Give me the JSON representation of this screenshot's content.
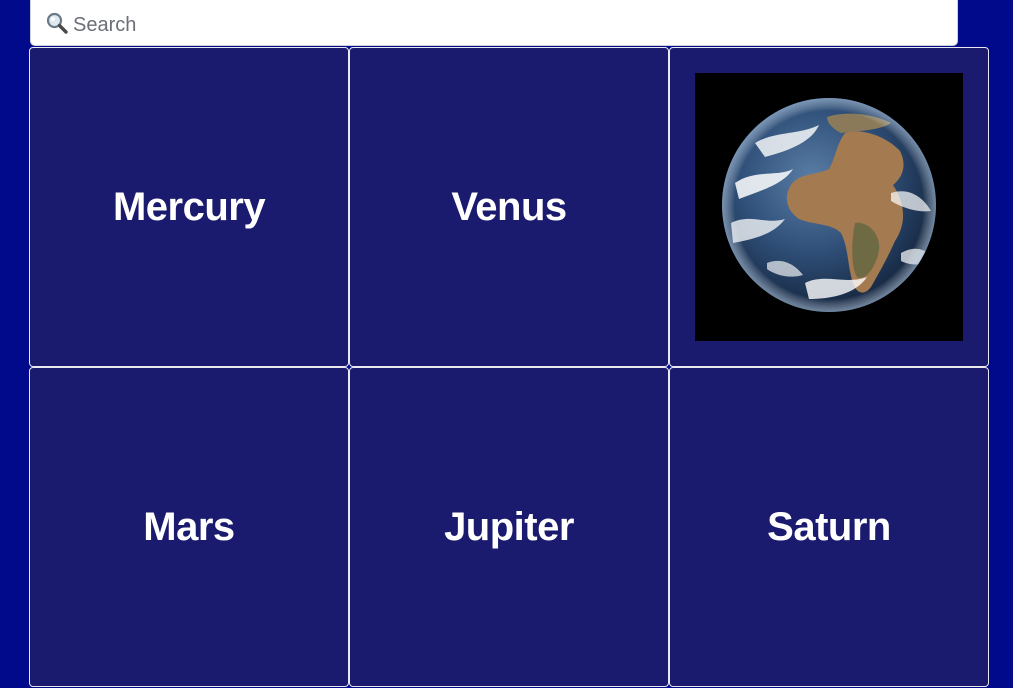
{
  "search": {
    "placeholder": "Search",
    "value": ""
  },
  "planets": [
    {
      "label": "Mercury",
      "shows_image": false
    },
    {
      "label": "Venus",
      "shows_image": false
    },
    {
      "label": "Earth",
      "shows_image": true,
      "image": "earth-photo"
    },
    {
      "label": "Mars",
      "shows_image": false
    },
    {
      "label": "Jupiter",
      "shows_image": false
    },
    {
      "label": "Saturn",
      "shows_image": false
    }
  ],
  "colors": {
    "page_background": "#000a8a",
    "tile_background": "#1a1a6e",
    "tile_border": "#e8e8ee",
    "label_text": "#ffffff"
  },
  "icons": {
    "search": "magnifying-glass-icon"
  }
}
